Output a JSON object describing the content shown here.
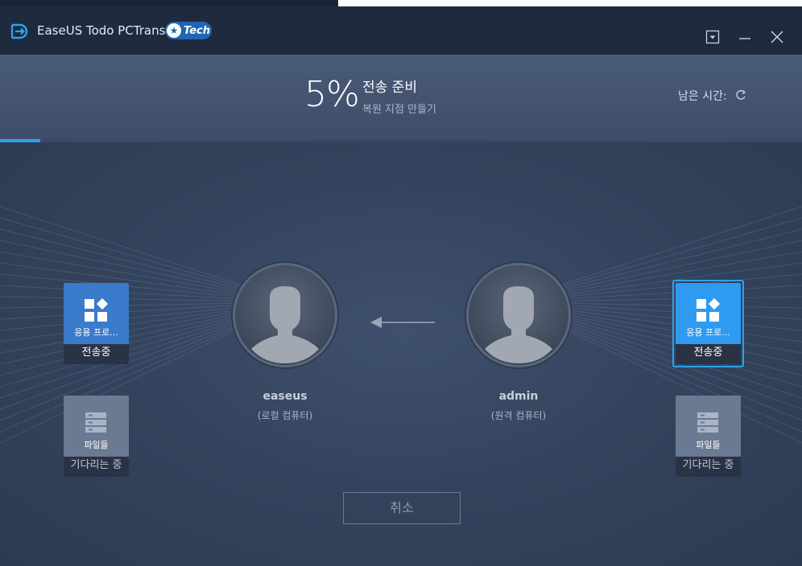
{
  "app": {
    "title": "EaseUS Todo PCTrans",
    "badge": "Tech",
    "logo_icon": "transfer-logo-icon"
  },
  "window_controls": [
    "menu-dropdown-icon",
    "minimize-icon",
    "close-icon"
  ],
  "status": {
    "percent": "5%",
    "title": "전송 준비",
    "subtitle": "복원 지점 만들기",
    "time_left_label": "남은 시간:",
    "progress_fraction": 0.05
  },
  "left_pc": {
    "name": "easeus",
    "role": "(로컬 컴퓨터)",
    "tiles": {
      "apps": {
        "label": "응용 프로...",
        "state": "전송중"
      },
      "files": {
        "label": "파일들",
        "state": "기다리는 중"
      }
    }
  },
  "right_pc": {
    "name": "admin",
    "role": "(원격 컴퓨터)",
    "tiles": {
      "apps": {
        "label": "응용 프로...",
        "state": "전송중"
      },
      "files": {
        "label": "파일들",
        "state": "기다리는 중"
      }
    }
  },
  "actions": {
    "cancel_label": "취소"
  },
  "colors": {
    "accent": "#2aa3ee",
    "titlebar": "#1e2a3e",
    "app_tile": "#3a7bcc",
    "file_tile": "#6b7a93"
  }
}
